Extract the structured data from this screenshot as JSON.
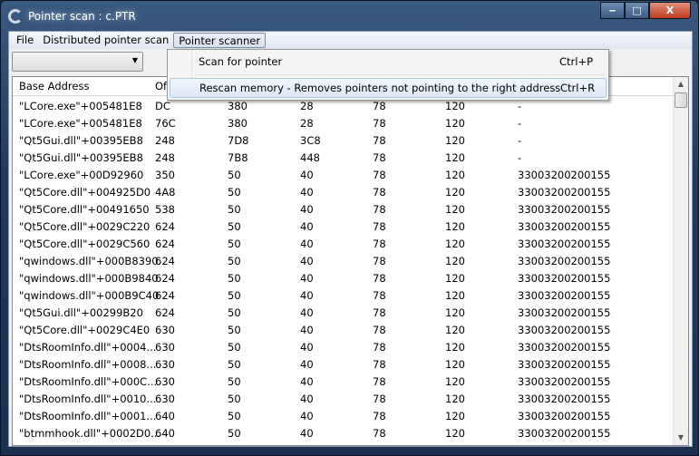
{
  "window": {
    "title": "Pointer scan : c.PTR",
    "minimize": "‒",
    "maximize": "□",
    "close": "X"
  },
  "menubar": [
    "File",
    "Distributed pointer scan",
    "Pointer scanner"
  ],
  "dropdown": {
    "items": [
      {
        "label": "Scan for pointer",
        "shortcut": "Ctrl+P"
      },
      {
        "label": "Rescan memory - Removes pointers not pointing to the right address",
        "shortcut": "Ctrl+R",
        "highlighted": true
      }
    ]
  },
  "combo": {
    "value": ""
  },
  "table": {
    "headers": [
      "Base Address",
      "Of"
    ],
    "rows": [
      [
        "\"LCore.exe\"+005481E8",
        "DC",
        "380",
        "28",
        "78",
        "120",
        "-"
      ],
      [
        "\"LCore.exe\"+005481E8",
        "76C",
        "380",
        "28",
        "78",
        "120",
        "-"
      ],
      [
        "\"Qt5Gui.dll\"+00395EB8",
        "248",
        "7D8",
        "3C8",
        "78",
        "120",
        "-"
      ],
      [
        "\"Qt5Gui.dll\"+00395EB8",
        "248",
        "7B8",
        "448",
        "78",
        "120",
        "-"
      ],
      [
        "\"LCore.exe\"+00D92960",
        "350",
        "50",
        "40",
        "78",
        "120",
        "33003200200155"
      ],
      [
        "\"Qt5Core.dll\"+004925D0",
        "4A8",
        "50",
        "40",
        "78",
        "120",
        "33003200200155"
      ],
      [
        "\"Qt5Core.dll\"+00491650",
        "538",
        "50",
        "40",
        "78",
        "120",
        "33003200200155"
      ],
      [
        "\"Qt5Core.dll\"+0029C220",
        "624",
        "50",
        "40",
        "78",
        "120",
        "33003200200155"
      ],
      [
        "\"Qt5Core.dll\"+0029C560",
        "624",
        "50",
        "40",
        "78",
        "120",
        "33003200200155"
      ],
      [
        "\"qwindows.dll\"+000B8390",
        "624",
        "50",
        "40",
        "78",
        "120",
        "33003200200155"
      ],
      [
        "\"qwindows.dll\"+000B9840",
        "624",
        "50",
        "40",
        "78",
        "120",
        "33003200200155"
      ],
      [
        "\"qwindows.dll\"+000B9C40",
        "624",
        "50",
        "40",
        "78",
        "120",
        "33003200200155"
      ],
      [
        "\"Qt5Gui.dll\"+00299B20",
        "624",
        "50",
        "40",
        "78",
        "120",
        "33003200200155"
      ],
      [
        "\"Qt5Core.dll\"+0029C4E0",
        "630",
        "50",
        "40",
        "78",
        "120",
        "33003200200155"
      ],
      [
        "\"DtsRoomInfo.dll\"+0004...",
        "630",
        "50",
        "40",
        "78",
        "120",
        "33003200200155"
      ],
      [
        "\"DtsRoomInfo.dll\"+0008...",
        "630",
        "50",
        "40",
        "78",
        "120",
        "33003200200155"
      ],
      [
        "\"DtsRoomInfo.dll\"+000C...",
        "630",
        "50",
        "40",
        "78",
        "120",
        "33003200200155"
      ],
      [
        "\"DtsRoomInfo.dll\"+0010...",
        "630",
        "50",
        "40",
        "78",
        "120",
        "33003200200155"
      ],
      [
        "\"DtsRoomInfo.dll\"+0001...",
        "640",
        "50",
        "40",
        "78",
        "120",
        "33003200200155"
      ],
      [
        "\"btmmhook.dll\"+0002D0...",
        "640",
        "50",
        "40",
        "78",
        "120",
        "33003200200155"
      ]
    ]
  },
  "scrollbar": {
    "up": "▲",
    "down": "▼",
    "position": 0
  }
}
